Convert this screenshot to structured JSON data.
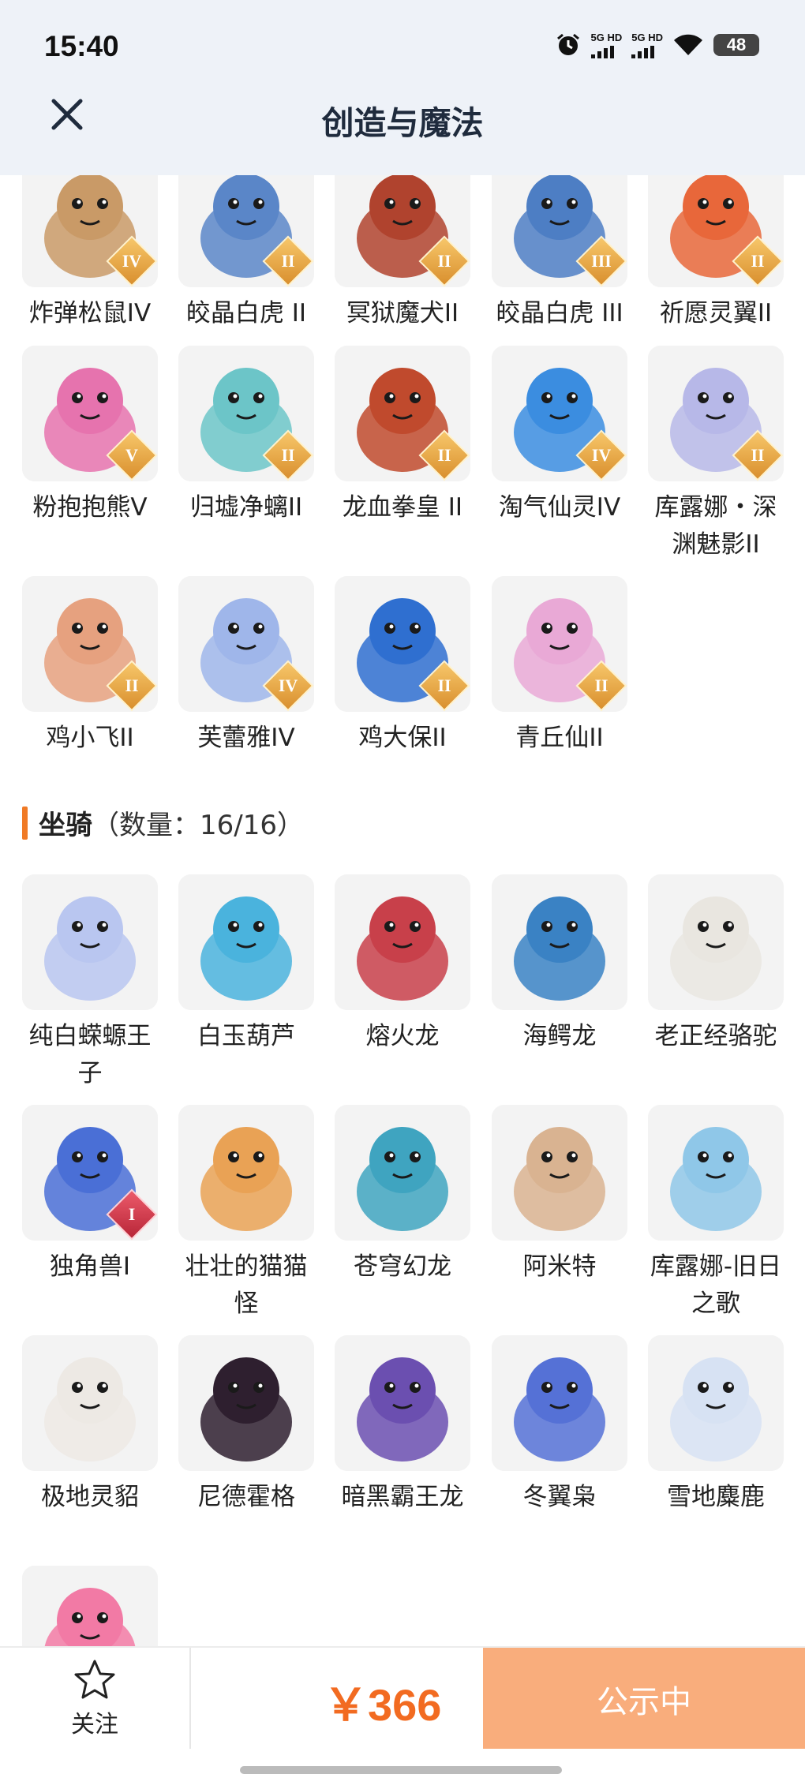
{
  "status_bar": {
    "time": "15:40",
    "network_1": "5G HD",
    "network_2": "5G HD",
    "battery": "48"
  },
  "nav": {
    "title": "创造与魔法",
    "close_icon": "close-icon"
  },
  "pets": [
    {
      "name": "炸弹松鼠IV",
      "tier": "IV",
      "color": "#c99a67"
    },
    {
      "name": "皎晶白虎 II",
      "tier": "II",
      "color": "#5a86c8"
    },
    {
      "name": "冥狱魔犬II",
      "tier": "II",
      "color": "#b0432e"
    },
    {
      "name": "皎晶白虎 III",
      "tier": "III",
      "color": "#4d7ec4"
    },
    {
      "name": "祈愿灵翼II",
      "tier": "II",
      "color": "#e8673a"
    },
    {
      "name": "粉抱抱熊Ⅴ",
      "tier": "V",
      "color": "#e673ae"
    },
    {
      "name": "归墟净螭II",
      "tier": "II",
      "color": "#6cc5c8"
    },
    {
      "name": "龙血拳皇 II",
      "tier": "II",
      "color": "#c04a2d"
    },
    {
      "name": "淘气仙灵IV",
      "tier": "IV",
      "color": "#3b8de0"
    },
    {
      "name": "库露娜・深渊魅影II",
      "tier": "II",
      "color": "#b7b8e8"
    },
    {
      "name": "鸡小飞II",
      "tier": "II",
      "color": "#e6a17f"
    },
    {
      "name": "芙蕾雅IV",
      "tier": "IV",
      "color": "#9fb6ea"
    },
    {
      "name": "鸡大保II",
      "tier": "II",
      "color": "#2f6fd0"
    },
    {
      "name": "青丘仙II",
      "tier": "II",
      "color": "#e9a9d6"
    }
  ],
  "mounts_section": {
    "title": "坐骑",
    "count_text": "（数量：16/16）"
  },
  "mounts": [
    {
      "name": "纯白蝾螈王子",
      "tier": "",
      "color": "#b9c6f0"
    },
    {
      "name": "白玉葫芦",
      "tier": "",
      "color": "#4ab3dd"
    },
    {
      "name": "熔火龙",
      "tier": "",
      "color": "#c8404a"
    },
    {
      "name": "海鳄龙",
      "tier": "",
      "color": "#3a82c4"
    },
    {
      "name": "老正经骆驼",
      "tier": "",
      "color": "#e9e6e0"
    },
    {
      "name": "独角兽I",
      "tier": "I",
      "color": "#4a6fd6"
    },
    {
      "name": "壮壮的猫猫怪",
      "tier": "",
      "color": "#e9a255"
    },
    {
      "name": "苍穹幻龙",
      "tier": "",
      "color": "#3fa4c0"
    },
    {
      "name": "阿米特",
      "tier": "",
      "color": "#d9b391"
    },
    {
      "name": "库露娜-旧日之歌",
      "tier": "",
      "color": "#8fc7e8"
    },
    {
      "name": "极地灵貂",
      "tier": "",
      "color": "#ede9e4"
    },
    {
      "name": "尼德霍格",
      "tier": "",
      "color": "#2e1f2f"
    },
    {
      "name": "暗黑霸王龙",
      "tier": "",
      "color": "#6b4fb0"
    },
    {
      "name": "冬翼枭",
      "tier": "",
      "color": "#5571d6"
    },
    {
      "name": "雪地麋鹿",
      "tier": "",
      "color": "#d7e2f3"
    },
    {
      "name": "",
      "tier": "",
      "color": "#f27aa5"
    }
  ],
  "bottom": {
    "follow_label": "关注",
    "price": "￥366",
    "cta_label": "公示中"
  },
  "colors": {
    "accent": "#f26b21",
    "cta": "#f9ad7c",
    "header_bg": "#eef2f8"
  }
}
